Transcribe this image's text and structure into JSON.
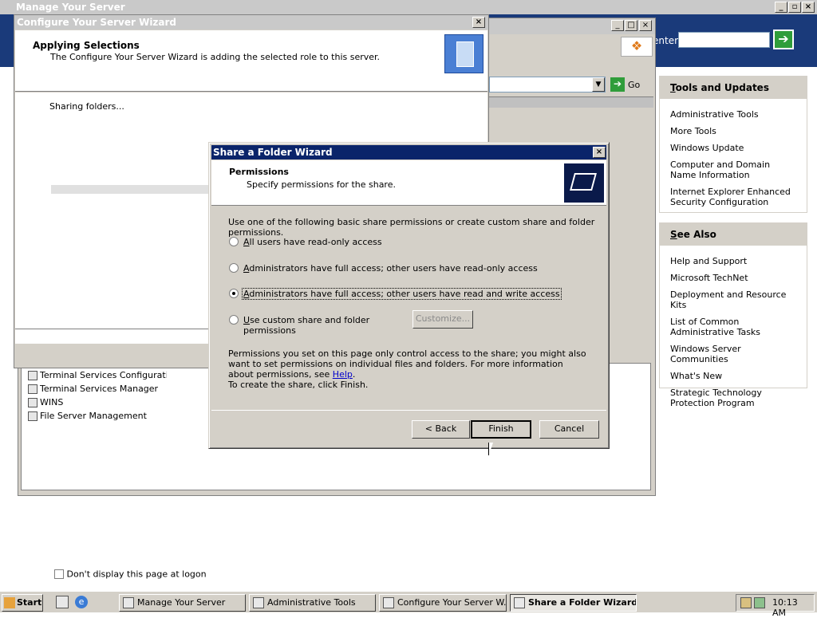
{
  "desktop": {
    "manage_window_title": "Manage Your Server",
    "search_label": "enter",
    "search_placeholder": "",
    "dont_display_label": "Don't display this page at logon"
  },
  "panels": {
    "tools": {
      "title": "Tools and Updates",
      "items": [
        "Administrative Tools",
        "More Tools",
        "Windows Update",
        "Computer and Domain Name Information",
        "Internet Explorer Enhanced Security Configuration"
      ]
    },
    "see_also": {
      "title": "See Also",
      "items": [
        "Help and Support",
        "Microsoft TechNet",
        "Deployment and Resource Kits",
        "List of Common Administrative Tasks",
        "Windows Server Communities",
        "What's New",
        "Strategic Technology Protection Program"
      ]
    }
  },
  "admin_tools": {
    "go_label": "Go",
    "items": [
      "Terminal Services Configuration",
      "Terminal Services Manager",
      "WINS",
      "File Server Management"
    ]
  },
  "cysw": {
    "title": "Configure Your Server Wizard",
    "heading": "Applying Selections",
    "subheading": "The Configure Your Server Wizard is adding the selected role to this server.",
    "status": "Sharing folders..."
  },
  "sfw": {
    "title": "Share a Folder Wizard",
    "heading": "Permissions",
    "subheading": "Specify permissions for the share.",
    "intro": "Use one of the following basic share permissions or create custom share and folder permissions.",
    "options": [
      {
        "label": "All users have read-only access",
        "selected": false
      },
      {
        "label": "Administrators have full access; other users have read-only access",
        "selected": false
      },
      {
        "label": "Administrators have full access; other users have read and write access",
        "selected": true
      },
      {
        "label": "Use custom share and folder permissions",
        "selected": false
      }
    ],
    "customize_label": "Customize...",
    "info_text": "Permissions you set on this page only control access to the share; you might also want to set permissions on individual files and folders. For more information about permissions, see",
    "help_link": "Help",
    "finish_text": "To create the share, click Finish.",
    "back_label": "< Back",
    "finish_label": "Finish",
    "cancel_label": "Cancel"
  },
  "taskbar": {
    "start_label": "Start",
    "tasks": [
      "Manage Your Server",
      "Administrative Tools",
      "Configure Your Server W...",
      "Share a Folder Wizard"
    ],
    "clock": "10:13 AM"
  }
}
